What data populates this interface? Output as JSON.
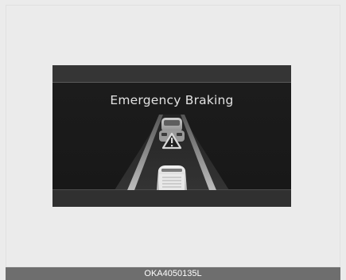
{
  "cluster_display": {
    "message": "Emergency Braking",
    "warning_icon": "warning-triangle-icon"
  },
  "caption": {
    "code": "OKA4050135L"
  }
}
